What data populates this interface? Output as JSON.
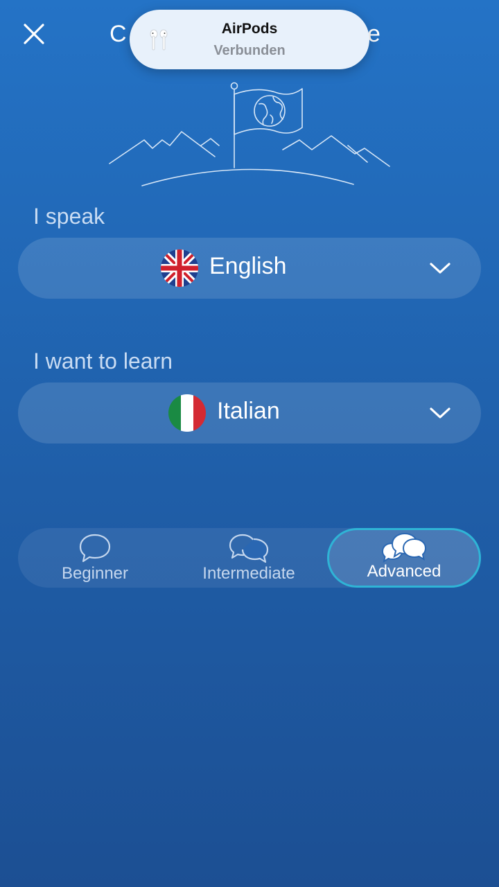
{
  "header": {
    "title_left": "C",
    "title_right": "e"
  },
  "toast": {
    "title": "AirPods",
    "subtitle": "Verbunden"
  },
  "speak": {
    "label": "I speak",
    "language": "English",
    "flag": "uk-flag"
  },
  "learn": {
    "label": "I want to learn",
    "language": "Italian",
    "flag": "italy-flag"
  },
  "levels": {
    "items": [
      {
        "label": "Beginner",
        "icon": "single-bubble-icon",
        "active": false
      },
      {
        "label": "Intermediate",
        "icon": "double-bubble-icon",
        "active": false
      },
      {
        "label": "Advanced",
        "icon": "triple-bubble-icon",
        "active": true
      }
    ]
  },
  "colors": {
    "background_top": "#2473c6",
    "background_bottom": "#1c4f93",
    "active_border": "#2fb4d6"
  }
}
